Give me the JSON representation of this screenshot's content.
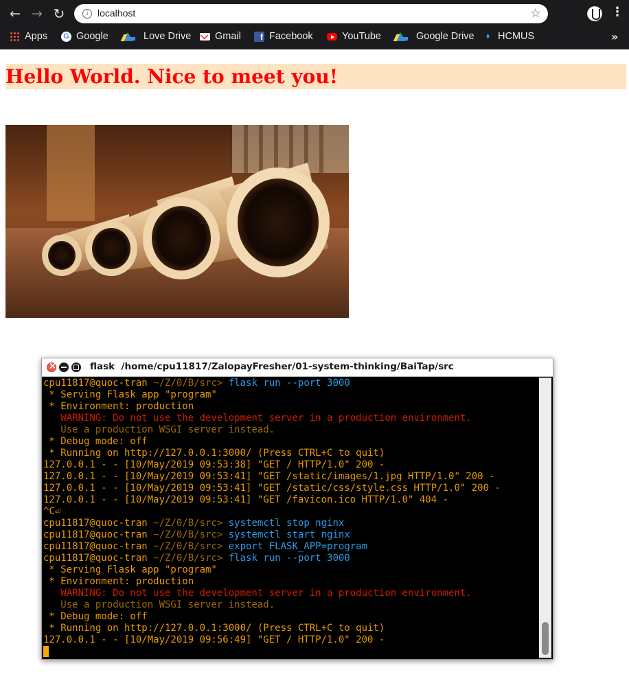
{
  "browser": {
    "url": "localhost",
    "nav": {
      "back": "←",
      "forward": "→",
      "reload": "↻"
    },
    "bookmarks": [
      {
        "label": "Apps",
        "icon": "apps-icon"
      },
      {
        "label": "Google",
        "icon": "google-icon"
      },
      {
        "label": "Love Drive",
        "icon": "drive-icon"
      },
      {
        "label": "Gmail",
        "icon": "gmail-icon"
      },
      {
        "label": "Facebook",
        "icon": "facebook-icon"
      },
      {
        "label": "YouTube",
        "icon": "youtube-icon"
      },
      {
        "label": "Google Drive",
        "icon": "drive-icon"
      },
      {
        "label": "HCMUS",
        "icon": "hcmus-icon"
      }
    ],
    "more_bookmarks": "»"
  },
  "page": {
    "heading": "Hello World. Nice to meet you!",
    "heading_color": "#ff0000",
    "heading_background": "#ffe4c4",
    "image_subject": "photo-pipes"
  },
  "terminal": {
    "title_app": "flask",
    "title_path": "/home/cpu11817/ZalopayFresher/01-system-thinking/BaiTap/src",
    "prompt_user": "cpu11817@quoc-tran",
    "prompt_path": "~/Z/0/B/src>",
    "lines": [
      {
        "type": "prompt",
        "cmd": "flask run --port 3000"
      },
      {
        "type": "out",
        "text": " * Serving Flask app \"program\""
      },
      {
        "type": "out",
        "text": " * Environment: production"
      },
      {
        "type": "warn",
        "text": "   WARNING: Do not use the development server in a production environment."
      },
      {
        "type": "dim",
        "text": "   Use a production WSGI server instead."
      },
      {
        "type": "out",
        "text": " * Debug mode: off"
      },
      {
        "type": "out",
        "text": " * Running on http://127.0.0.1:3000/ (Press CTRL+C to quit)"
      },
      {
        "type": "out",
        "text": "127.0.0.1 - - [10/May/2019 09:53:38] \"GET / HTTP/1.0\" 200 -"
      },
      {
        "type": "out",
        "text": "127.0.0.1 - - [10/May/2019 09:53:41] \"GET /static/images/1.jpg HTTP/1.0\" 200 -"
      },
      {
        "type": "out",
        "text": "127.0.0.1 - - [10/May/2019 09:53:41] \"GET /static/css/style.css HTTP/1.0\" 200 -"
      },
      {
        "type": "out",
        "text": "127.0.0.1 - - [10/May/2019 09:53:41] \"GET /favicon.ico HTTP/1.0\" 404 -"
      },
      {
        "type": "out",
        "text": "^C⏎"
      },
      {
        "type": "prompt",
        "cmd": "systemctl stop nginx"
      },
      {
        "type": "prompt",
        "cmd": "systemctl start nginx"
      },
      {
        "type": "prompt",
        "cmd": "export FLASK_APP=program"
      },
      {
        "type": "prompt",
        "cmd": "flask run --port 3000"
      },
      {
        "type": "out",
        "text": " * Serving Flask app \"program\""
      },
      {
        "type": "out",
        "text": " * Environment: production"
      },
      {
        "type": "warn",
        "text": "   WARNING: Do not use the development server in a production environment."
      },
      {
        "type": "dim",
        "text": "   Use a production WSGI server instead."
      },
      {
        "type": "out",
        "text": " * Debug mode: off"
      },
      {
        "type": "out",
        "text": " * Running on http://127.0.0.1:3000/ (Press CTRL+C to quit)"
      },
      {
        "type": "out",
        "text": "127.0.0.1 - - [10/May/2019 09:56:49] \"GET / HTTP/1.0\" 200 -"
      },
      {
        "type": "cursor"
      }
    ],
    "colors": {
      "prompt": "#e69a00",
      "path": "#9c6a00",
      "command": "#2c9be8",
      "warning": "#cc1a00",
      "background": "#000000"
    }
  }
}
